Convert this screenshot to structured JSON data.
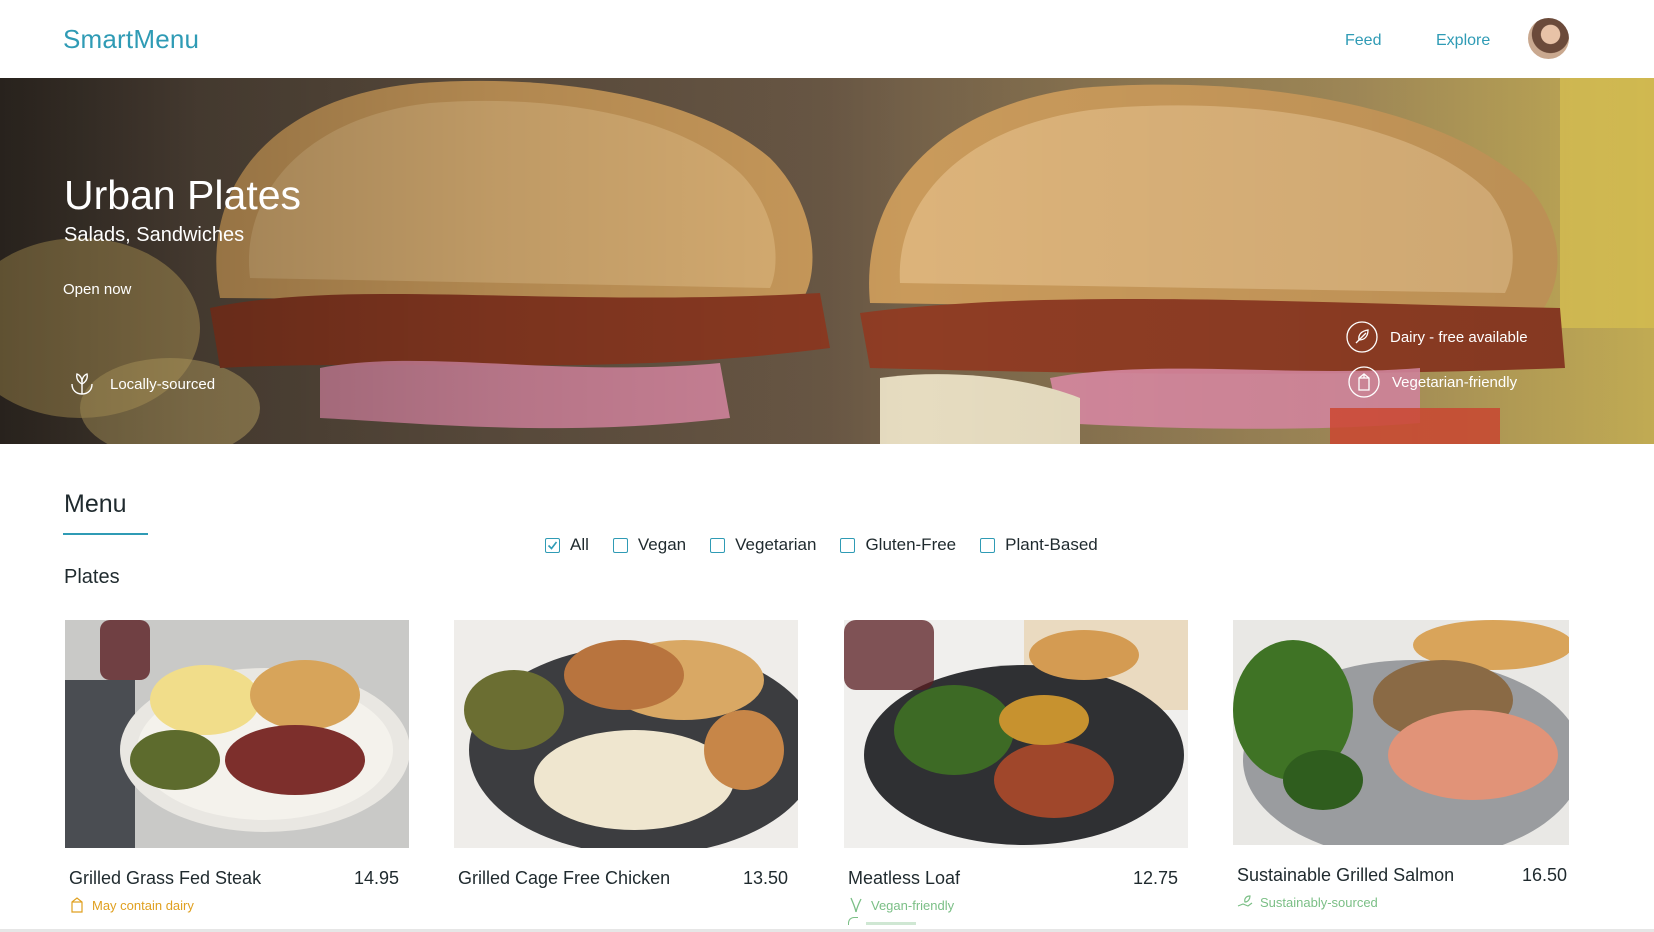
{
  "header": {
    "logo": "SmartMenu",
    "nav": {
      "feed": "Feed",
      "explore": "Explore"
    }
  },
  "hero": {
    "title": "Urban Plates",
    "subtitle": "Salads, Sandwiches",
    "status": "Open now",
    "features": {
      "local": {
        "label": "Locally-sourced",
        "icon": "hands-plant-icon"
      },
      "dairy": {
        "label": "Dairy - free available",
        "icon": "leaf-icon"
      },
      "veg": {
        "label": "Vegetarian-friendly",
        "icon": "carton-icon"
      }
    }
  },
  "menu": {
    "title": "Menu",
    "filters": [
      {
        "label": "All",
        "checked": true
      },
      {
        "label": "Vegan",
        "checked": false
      },
      {
        "label": "Vegetarian",
        "checked": false
      },
      {
        "label": "Gluten-Free",
        "checked": false
      },
      {
        "label": "Plant-Based",
        "checked": false
      }
    ],
    "section": "Plates",
    "items": [
      {
        "name": "Grilled Grass Fed Steak",
        "price": "14.95",
        "tag": "May contain dairy",
        "tag_icon": "carton-icon"
      },
      {
        "name": "Grilled Cage Free Chicken",
        "price": "13.50",
        "tag": "",
        "tag_icon": ""
      },
      {
        "name": "Meatless Loaf",
        "price": "12.75",
        "tag": "Vegan-friendly",
        "tag_icon": "sprout-icon"
      },
      {
        "name": "Sustainable Grilled Salmon",
        "price": "16.50",
        "tag": "Sustainably-sourced",
        "tag_icon": "hand-leaf-icon"
      }
    ]
  },
  "colors": {
    "accent": "#2f9bb5",
    "warning": "#e0a020",
    "green": "#7bbf86",
    "text": "#1f2a2e"
  }
}
